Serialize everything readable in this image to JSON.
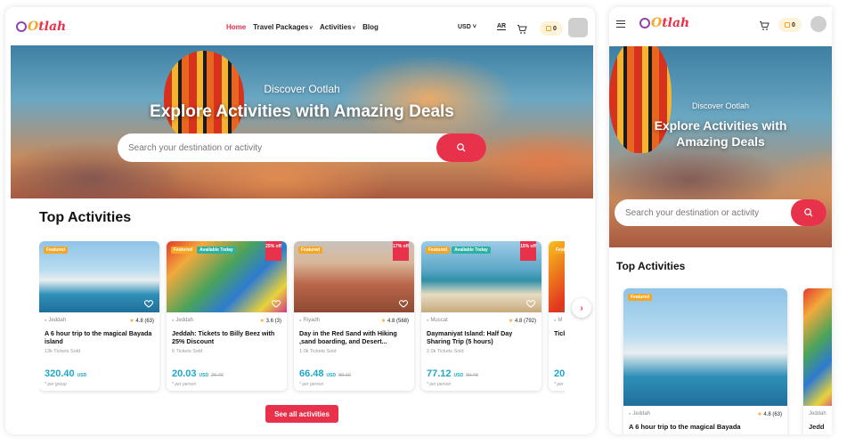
{
  "brand": {
    "name": "tlah",
    "o": "O"
  },
  "nav": {
    "items": [
      {
        "label": "Home",
        "active": true
      },
      {
        "label": "Travel Packages",
        "caret": "˅"
      },
      {
        "label": "Activities",
        "caret": "˅"
      },
      {
        "label": "Blog"
      }
    ],
    "currency": "USD ˅",
    "language": "AR",
    "cart_count": "0"
  },
  "hero": {
    "subtitle": "Discover Ootlah",
    "title": "Explore Activities with Amazing Deals",
    "search_placeholder": "Search your destination or activity"
  },
  "section": {
    "title": "Top Activities",
    "see_all": "See all activities",
    "next": "›"
  },
  "cards": [
    {
      "image": "boat",
      "badges": [
        "Featured"
      ],
      "discount": "",
      "location": "Jeddah",
      "rating": "4.8",
      "reviews": "(63)",
      "title": "A 6 hour trip to the magical Bayada island",
      "sold": "13k Tickets Sold",
      "price": "320.40",
      "currency": "USD",
      "old_price": "",
      "per": "* per group"
    },
    {
      "image": "park",
      "badges": [
        "Featured",
        "Available Today"
      ],
      "discount": "25% off",
      "location": "Jeddah",
      "rating": "3.6",
      "reviews": "(3)",
      "title": "Jeddah: Tickets to Billy Beez with 25% Discount",
      "sold": "6 Tickets Sold",
      "price": "20.03",
      "currency": "USD",
      "old_price": "26.70",
      "per": "* per person"
    },
    {
      "image": "sand",
      "badges": [
        "Featured"
      ],
      "discount": "17% off",
      "location": "Riyadh",
      "rating": "4.8",
      "reviews": "(568)",
      "title": "Day in the Red Sand with Hiking ,sand boarding, and Desert...",
      "sold": "1.0k Tickets Sold",
      "price": "66.48",
      "currency": "USD",
      "old_price": "80.10",
      "per": "* per person"
    },
    {
      "image": "beach",
      "badges": [
        "Featured",
        "Available Today"
      ],
      "discount": "15% off",
      "location": "Muscat",
      "rating": "4.8",
      "reviews": "(792)",
      "title": "Daymaniyat Island: Half Day Sharing Trip (5 hours)",
      "sold": "2.0k Tickets Sold",
      "price": "77.12",
      "currency": "USD",
      "old_price": "90.73",
      "per": "* per person"
    },
    {
      "image": "color",
      "badges": [
        "Featured"
      ],
      "discount": "",
      "location": "M",
      "rating": "",
      "reviews": "",
      "title": "Tick Disc",
      "sold": "",
      "price": "20.",
      "currency": "",
      "old_price": "",
      "per": "* per"
    }
  ],
  "mobile": {
    "hero_title": "Explore Activities with Amazing Deals",
    "card": {
      "badge": "Featured",
      "location": "Jeddah",
      "rating": "4.8",
      "reviews": "(63)",
      "title": "A 6 hour trip to the magical Bayada"
    },
    "card2": {
      "location": "Jeddah",
      "title": "Jedd"
    }
  },
  "colors": {
    "accent": "#e8314a",
    "price": "#1ea7c6",
    "star": "#f5a623"
  }
}
